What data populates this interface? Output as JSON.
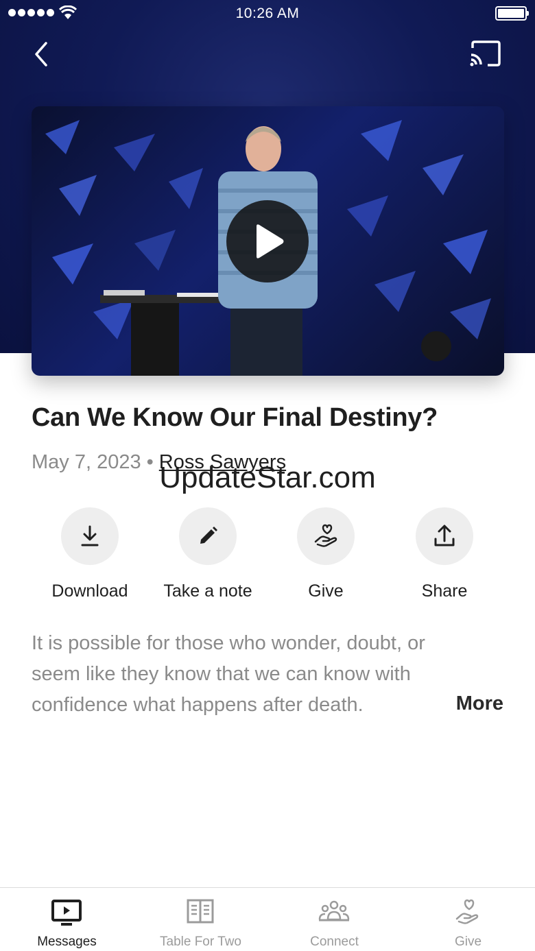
{
  "status_bar": {
    "time": "10:26 AM"
  },
  "header": {
    "back_icon": "chevron-left-icon",
    "cast_icon": "cast-icon"
  },
  "video": {
    "play_icon": "play-icon"
  },
  "sermon": {
    "title": "Can We Know Our Final Destiny?",
    "date": "May 7, 2023",
    "separator": "•",
    "speaker": "Ross Sawyers",
    "description": "It is possible for those who wonder, doubt, or seem like they know that we can know with confidence what happens after death.",
    "more_label": "More"
  },
  "watermark": "UpdateStar.com",
  "actions": [
    {
      "label": "Download",
      "icon": "download-icon"
    },
    {
      "label": "Take a note",
      "icon": "pencil-icon"
    },
    {
      "label": "Give",
      "icon": "give-heart-hand-icon"
    },
    {
      "label": "Share",
      "icon": "share-icon"
    }
  ],
  "tabs": [
    {
      "label": "Messages",
      "icon": "tv-play-icon",
      "active": true
    },
    {
      "label": "Table For Two",
      "icon": "open-book-icon",
      "active": false
    },
    {
      "label": "Connect",
      "icon": "people-group-icon",
      "active": false
    },
    {
      "label": "Give",
      "icon": "give-heart-hand-icon",
      "active": false
    }
  ],
  "colors": {
    "hero": "#101a55",
    "text": "#1f1f1f",
    "muted": "#8a8a8a",
    "chip": "#eeeeee"
  }
}
